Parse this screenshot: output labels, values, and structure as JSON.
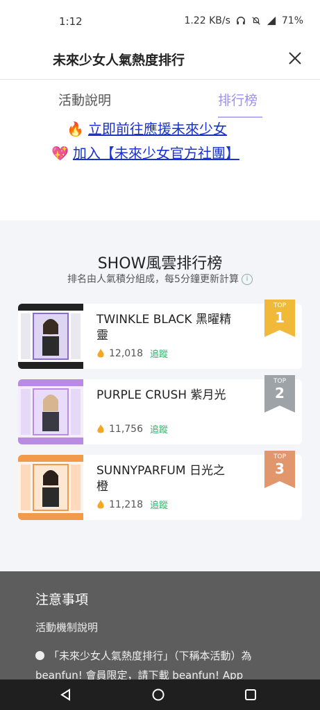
{
  "status_bar": {
    "time": "1:12",
    "network_speed": "1.22 KB/s",
    "battery": "71%"
  },
  "header": {
    "title": "未來少女人氣熱度排行",
    "close_icon": "close-icon"
  },
  "tabs": [
    {
      "label": "活動說明",
      "active": false
    },
    {
      "label": "排行榜",
      "active": true
    }
  ],
  "links": [
    {
      "emoji": "🔥",
      "label": "立即前往應援未來少女"
    },
    {
      "emoji": "💖",
      "label": "加入【未來少女官方社團】"
    }
  ],
  "ranking": {
    "title": "SHOW風雲排行榜",
    "subtitle": "排名由人氣積分組成，每5分鐘更新計算",
    "items": [
      {
        "rank": "1",
        "badge_label": "TOP",
        "name": "TWINKLE BLACK 黑曜精靈",
        "score": "12,018",
        "follow_label": "追蹤",
        "badge_color": "#f1b93a",
        "theme_color": "#8a6bd6"
      },
      {
        "rank": "2",
        "badge_label": "TOP",
        "name": "PURPLE CRUSH 紫月光",
        "score": "11,756",
        "follow_label": "追蹤",
        "badge_color": "#9ea3a8",
        "theme_color": "#b98be3"
      },
      {
        "rank": "3",
        "badge_label": "TOP",
        "name": "SUNNYPARFUM 日光之橙",
        "score": "11,218",
        "follow_label": "追蹤",
        "badge_color": "#e2966c",
        "theme_color": "#f29a4b"
      }
    ]
  },
  "notes": {
    "title": "注意事項",
    "subtitle": "活動機制說明",
    "body": "「未來少女人氣熱度排行」（下稱本活動）為 beanfun! 會員限定，請下載 beanfun! App"
  }
}
